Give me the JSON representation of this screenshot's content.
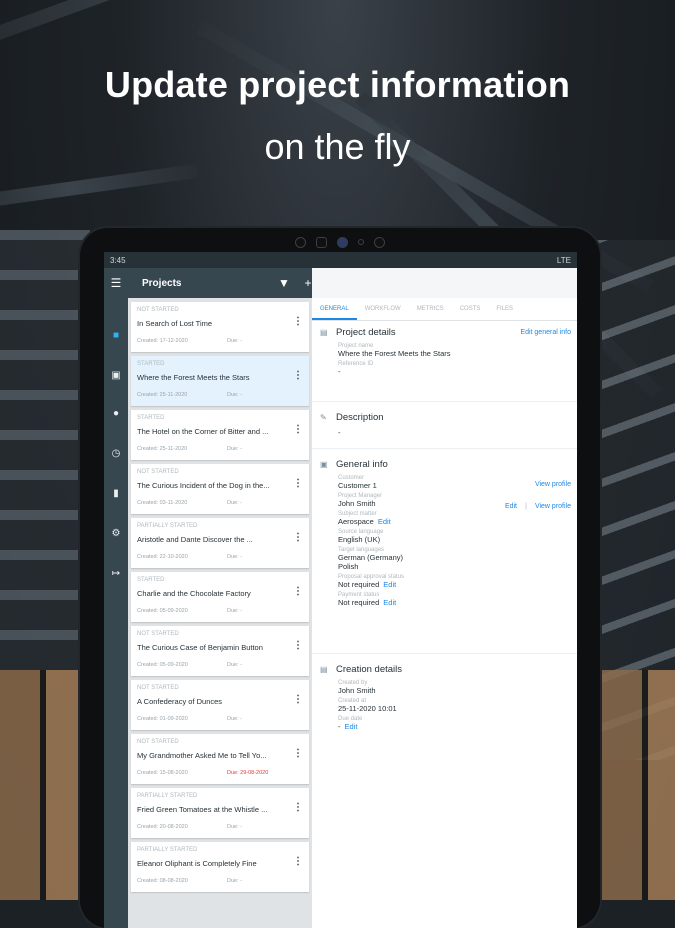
{
  "headline": {
    "line1": "Update project information",
    "line2": "on the fly"
  },
  "status_bar": {
    "time": "3:45",
    "signal": "LTE"
  },
  "app_bar": {
    "title": "Projects",
    "filter_icon": "filter-icon",
    "add_icon": "plus-icon"
  },
  "rail": {
    "items": [
      "document-icon",
      "inbox-icon",
      "people-icon",
      "clock-icon",
      "file-icon",
      "gear-icon",
      "export-icon"
    ]
  },
  "projects": [
    {
      "status": "NOT STARTED",
      "name": "In Search of Lost Time",
      "created": "Created: 17-12-2020",
      "due": "Due: -"
    },
    {
      "status": "STARTED",
      "name": "Where the Forest Meets the Stars",
      "created": "Created: 25-11-2020",
      "due": "Due: -"
    },
    {
      "status": "STARTED",
      "name": "The Hotel on the Corner of Bitter and ...",
      "created": "Created: 25-11-2020",
      "due": "Due: -"
    },
    {
      "status": "NOT STARTED",
      "name": "The Curious Incident of the Dog in the...",
      "created": "Created: 03-11-2020",
      "due": "Due: -"
    },
    {
      "status": "PARTIALLY STARTED",
      "name": "Aristotle and Dante Discover the ...",
      "created": "Created: 22-10-2020",
      "due": "Due: -"
    },
    {
      "status": "STARTED",
      "name": "Charlie and the Chocolate Factory",
      "created": "Created: 05-09-2020",
      "due": "Due: -"
    },
    {
      "status": "NOT STARTED",
      "name": "The Curious Case of Benjamin Button",
      "created": "Created: 05-09-2020",
      "due": "Due: -"
    },
    {
      "status": "NOT STARTED",
      "name": "A Confederacy of Dunces",
      "created": "Created: 01-09-2020",
      "due": "Due: -"
    },
    {
      "status": "NOT STARTED",
      "name": "My Grandmother Asked Me to Tell Yo...",
      "created": "Created: 15-08-2020",
      "due": "Due: 29-08-2020"
    },
    {
      "status": "PARTIALLY STARTED",
      "name": "Fried Green Tomatoes at the Whistle ...",
      "created": "Created: 20-08-2020",
      "due": "Due: -"
    },
    {
      "status": "PARTIALLY STARTED",
      "name": "Eleanor Oliphant is Completely Fine",
      "created": "Created: 08-08-2020",
      "due": "Due: -"
    }
  ],
  "tabs": [
    "GENERAL",
    "WORKFLOW",
    "METRICS",
    "COSTS",
    "FILES"
  ],
  "project_details": {
    "title": "Project details",
    "edit_link": "Edit general info",
    "name_label": "Project name",
    "name_value": "Where the Forest Meets the Stars",
    "ref_label": "Reference ID",
    "ref_value": "-"
  },
  "description": {
    "title": "Description",
    "value": "-"
  },
  "general_info": {
    "title": "General info",
    "customer_label": "Customer",
    "customer_value": "Customer 1",
    "view_profile": "View profile",
    "pm_label": "Project Manager",
    "pm_value": "John Smith",
    "edit": "Edit",
    "separator": "|",
    "subject_label": "Subject matter",
    "subject_value": "Aerospace",
    "source_label": "Source language",
    "source_value": "English (UK)",
    "target_label": "Target languages",
    "target_value1": "German (Germany)",
    "target_value2": "Polish",
    "proposal_label": "Proposal approval status",
    "proposal_value": "Not required",
    "payment_label": "Payment status",
    "payment_value": "Not required"
  },
  "creation_details": {
    "title": "Creation details",
    "created_by_label": "Created by",
    "created_by_value": "John Smith",
    "created_at_label": "Created at",
    "created_at_value": "25-11-2020 10:01",
    "due_label": "Due date",
    "due_value": "-"
  }
}
